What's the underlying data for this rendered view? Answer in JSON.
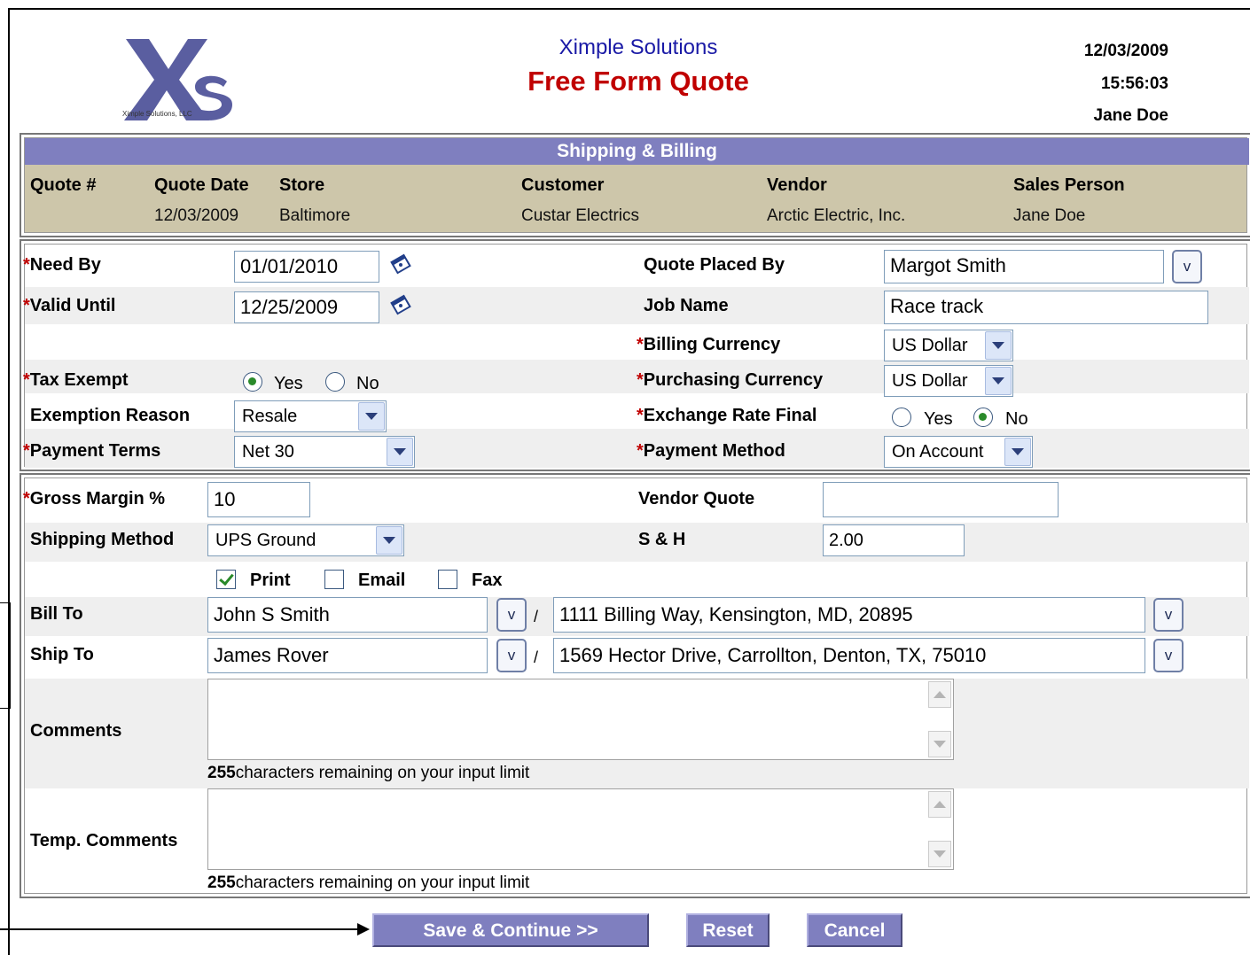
{
  "header": {
    "company": "Ximple Solutions",
    "title": "Free Form Quote",
    "date": "12/03/2009",
    "time": "15:56:03",
    "user": "Jane Doe",
    "logo_text": "Ximple Solutions, LLC"
  },
  "summary": {
    "band_title": "Shipping & Billing",
    "columns": [
      "Quote #",
      "Quote Date",
      "Store",
      "Customer",
      "Vendor",
      "Sales Person"
    ],
    "values": [
      "",
      "12/03/2009",
      "Baltimore",
      "Custar Electrics",
      "Arctic Electric, Inc.",
      "Jane Doe"
    ]
  },
  "form": {
    "need_by": {
      "label": "Need By",
      "value": "01/01/2010"
    },
    "valid_until": {
      "label": "Valid Until",
      "value": "12/25/2009"
    },
    "quote_placed_by": {
      "label": "Quote Placed By",
      "value": "Margot Smith"
    },
    "job_name": {
      "label": "Job Name",
      "value": "Race track"
    },
    "billing_currency": {
      "label": "Billing Currency",
      "value": "US Dollar"
    },
    "purchasing_currency": {
      "label": "Purchasing Currency",
      "value": "US Dollar"
    },
    "tax_exempt": {
      "label": "Tax Exempt",
      "yes": "Yes",
      "no": "No",
      "selected": "Yes"
    },
    "exemption_reason": {
      "label": "Exemption Reason",
      "value": "Resale"
    },
    "exchange_rate_final": {
      "label": "Exchange Rate Final",
      "yes": "Yes",
      "no": "No",
      "selected": "No"
    },
    "payment_terms": {
      "label": "Payment Terms",
      "value": "Net 30"
    },
    "payment_method": {
      "label": "Payment Method",
      "value": "On Account"
    },
    "required_mark": "*",
    "v_label": "v",
    "slash": "/"
  },
  "shipping": {
    "gross_margin": {
      "label": "Gross Margin %",
      "value": "10"
    },
    "vendor_quote": {
      "label": "Vendor Quote",
      "value": ""
    },
    "shipping_method": {
      "label": "Shipping Method",
      "value": "UPS Ground"
    },
    "s_and_h": {
      "label": "S & H",
      "value": "2.00"
    },
    "print": {
      "label": "Print",
      "checked": true
    },
    "email": {
      "label": "Email",
      "checked": false
    },
    "fax": {
      "label": "Fax",
      "checked": false
    },
    "bill_to": {
      "label": "Bill To",
      "name": "John S Smith",
      "address": "1111 Billing Way, Kensington, MD, 20895"
    },
    "ship_to": {
      "label": "Ship To",
      "name": "James Rover",
      "address": "1569 Hector Drive, Carrollton, Denton, TX, 75010"
    },
    "comments": {
      "label": "Comments",
      "remaining_count": "255",
      "remaining_text": "characters remaining on your input limit"
    },
    "temp_comments": {
      "label": "Temp. Comments",
      "remaining_count": "255",
      "remaining_text": "characters remaining on your input limit"
    }
  },
  "buttons": {
    "save": "Save & Continue >>",
    "reset": "Reset",
    "cancel": "Cancel"
  },
  "colors": {
    "band": "#7f7fbf",
    "tan_row": "#cdc6aa",
    "title_red": "#c00000",
    "company_blue": "#1a1aa6"
  }
}
